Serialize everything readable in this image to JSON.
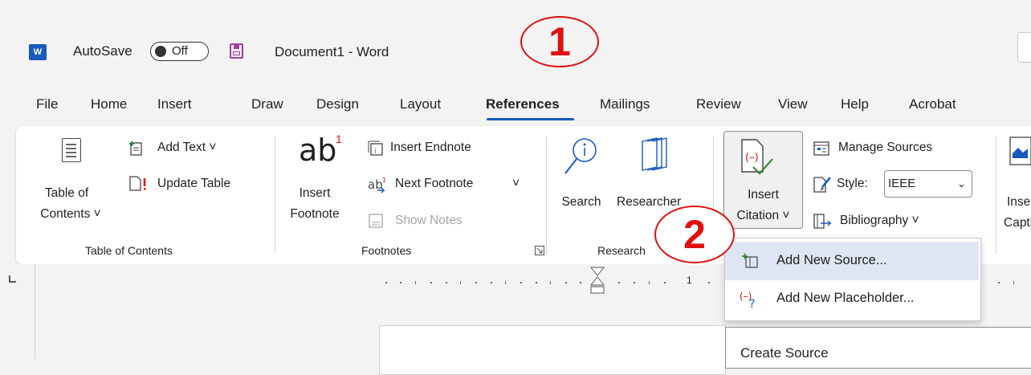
{
  "titlebar": {
    "app_badge": "W",
    "autosave_label": "AutoSave",
    "autosave_state": "Off",
    "document_title": "Document1  -  Word"
  },
  "annotations": {
    "step1": "1",
    "step2": "2",
    "color": "#e01010"
  },
  "tabs": [
    "File",
    "Home",
    "Insert",
    "Draw",
    "Design",
    "Layout",
    "References",
    "Mailings",
    "Review",
    "View",
    "Help",
    "Acrobat"
  ],
  "active_tab": "References",
  "ribbon": {
    "toc": {
      "btn_line1": "Table of",
      "btn_line2": "Contents ˅",
      "add_text": "Add Text ˅",
      "update_table": "Update Table",
      "group_label": "Table of Contents"
    },
    "footnotes": {
      "ab_glyph": "ab",
      "superscript": "1",
      "insert_footnote_line1": "Insert",
      "insert_footnote_line2": "Footnote",
      "insert_endnote": "Insert Endnote",
      "next_footnote": "Next Footnote",
      "next_footnote_arrow": "˅",
      "show_notes": "Show Notes",
      "group_label": "Footnotes"
    },
    "research": {
      "search": "Search",
      "researcher": "Researcher",
      "group_label": "Research"
    },
    "citations": {
      "insert_citation_line1": "Insert",
      "insert_citation_line2": "Citation ˅",
      "manage_sources": "Manage Sources",
      "style_label": "Style:",
      "style_value": "IEEE",
      "bibliography": "Bibliography ˅"
    },
    "captions": {
      "insert_caption_line1": "Insert",
      "insert_caption_line2": "Caption"
    }
  },
  "dropdown": {
    "items": [
      {
        "label": "Add New Source..."
      },
      {
        "label": "Add New Placeholder..."
      }
    ]
  },
  "dialog": {
    "title": "Create Source"
  },
  "ruler": {
    "number": "1"
  },
  "colors": {
    "accent": "#185abd",
    "hover": "#dfe6f3",
    "save_icon": "#a13ea3",
    "citation_icon_red": "#e01010",
    "citation_check_green": "#2e7d32"
  }
}
